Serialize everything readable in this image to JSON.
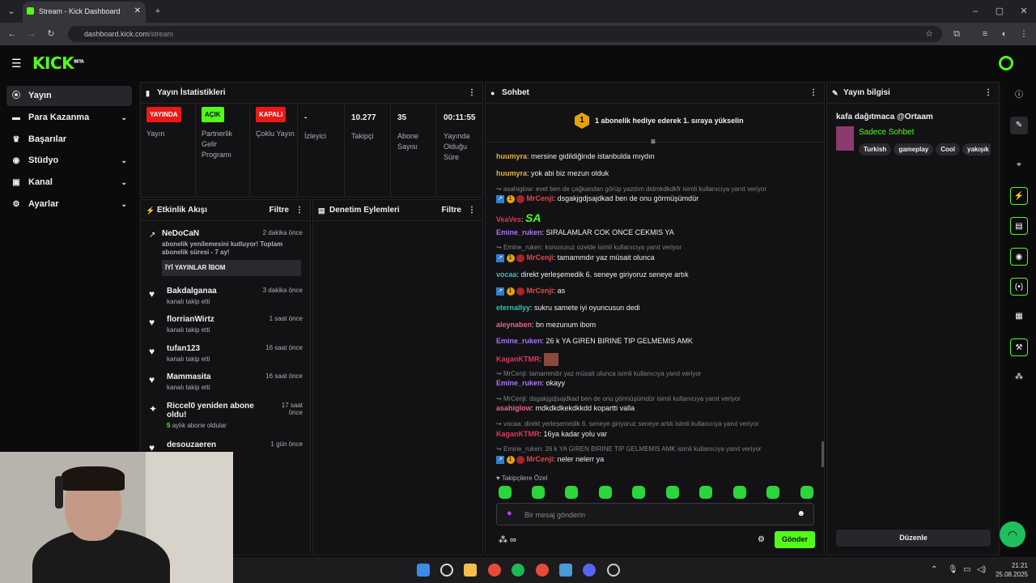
{
  "browser": {
    "tab_title": "Stream - Kick Dashboard",
    "url_domain": "dashboard.kick.com",
    "url_path": "/stream"
  },
  "logo": {
    "text": "KICK",
    "beta": "BETA"
  },
  "sidebar": {
    "items": [
      {
        "label": "Yayın",
        "icon": "stream-icon"
      },
      {
        "label": "Para Kazanma",
        "icon": "money-icon"
      },
      {
        "label": "Başarılar",
        "icon": "trophy-icon"
      },
      {
        "label": "Stüdyo",
        "icon": "studio-icon"
      },
      {
        "label": "Kanal",
        "icon": "channel-icon"
      },
      {
        "label": "Ayarlar",
        "icon": "gear-icon"
      }
    ]
  },
  "stats": {
    "title": "Yayın İstatistikleri",
    "items": [
      {
        "badge": "YAYINDA",
        "label": "Yayın"
      },
      {
        "badge": "AÇIK",
        "label": "Partnerlik Gelir Programı"
      },
      {
        "badge": "KAPALI",
        "label": "Çoklu Yayın"
      },
      {
        "value": "-",
        "label": "İzleyici"
      },
      {
        "value": "10.277",
        "label": "Takipçi"
      },
      {
        "value": "35",
        "label": "Abone Sayısı"
      },
      {
        "value": "00:11:55",
        "label": "Yayında Olduğu Süre"
      }
    ],
    "colors": {
      "live": "#e91916",
      "on": "#53fc18",
      "off": "#e91916"
    }
  },
  "activity": {
    "title": "Etkinlik Akışı",
    "filter": "Filtre",
    "events": [
      {
        "name": "NeDoCaN",
        "time": "2 dakika önce",
        "sub": "abonelik yenilemesini kutluyor! Toplam abonelik süresi - 7 ay!",
        "message": "İYİ YAYINLAR İBOM"
      },
      {
        "name": "Bakdalganaa",
        "time": "3 dakika önce",
        "sub": "kanalı takip etti"
      },
      {
        "name": "florrianWirtz",
        "time": "1 saat önce",
        "sub": "kanalı takip etti"
      },
      {
        "name": "tufan123",
        "time": "16 saat önce",
        "sub": "kanalı takip etti"
      },
      {
        "name": "Mammasita",
        "time": "16 saat önce",
        "sub": "kanalı takip etti"
      },
      {
        "name": "Riccel0 yeniden abone oldu!",
        "time": "17 saat önce",
        "sub_count": "5",
        "sub": "aylık abone oldular"
      },
      {
        "name": "desouzaeren",
        "time": "1 gün önce"
      }
    ]
  },
  "moderation": {
    "title": "Denetim Eylemleri",
    "filter": "Filtre"
  },
  "chat": {
    "title": "Sohbet",
    "goal_number": "1",
    "goal_text": "1 abonelik hediye ederek 1. sıraya yükselin",
    "messages": [
      {
        "user": "huumyra",
        "color": "#e0b341",
        "text": "mersine gidildiğinde istanbulda mıydın"
      },
      {
        "user": "huumyra",
        "color": "#e0b341",
        "text": "yok abi biz mezun olduk"
      },
      {
        "reply": "asahiglow: evet ben de çağkandan görüp yazdım didmkdkdkfr isimli kullanıcıya yanıt veriyor"
      },
      {
        "user": "MrCenji",
        "color": "#e0474c",
        "badges": true,
        "text": "dsgakjgdjsajdkad ben de onu görmüşümdür"
      },
      {
        "user": "VeaVes",
        "color": "#e0365a",
        "emote": "SA"
      },
      {
        "user": "Emine_ruken",
        "color": "#a973f5",
        "text": "SIRALAMLAR COK ONCE CEKMIS YA"
      },
      {
        "reply": "Emine_ruken: konusuruz ozelde isimli kullanıcıya yanıt veriyor"
      },
      {
        "user": "MrCenji",
        "color": "#e0474c",
        "badges": true,
        "text": "tamammdır yaz müsait olunca"
      },
      {
        "user": "vocaa",
        "color": "#2ec4b6",
        "text": "direkt yerleşemedik 6. seneye giriyoruz seneye artık"
      },
      {
        "user": "MrCenji",
        "color": "#e0474c",
        "badges": true,
        "text": "as"
      },
      {
        "user": "eternallyy",
        "color": "#2ec4b6",
        "text": "sukru samete iyi oyuncusun dedi"
      },
      {
        "user": "aleynaben",
        "color": "#e8628e",
        "text": "bn mezunum ibom"
      },
      {
        "user": "Emine_ruken",
        "color": "#a973f5",
        "text": "26 k YA GIREN BIRINE TIP GELMEMIS AMK"
      },
      {
        "user": "KaganKTMR",
        "color": "#e0365a",
        "image": true
      },
      {
        "reply": "MrCenji: tamammdır yaz müsait olunca isimli kullanıcıya yanıt veriyor"
      },
      {
        "user": "Emine_ruken",
        "color": "#a973f5",
        "text": "okayy"
      },
      {
        "reply": "MrCenji: dsgakjgdjsajdkad ben de onu görmüşümdür isimli kullanıcıya yanıt veriyor"
      },
      {
        "user": "asahiglow",
        "color": "#e8628e",
        "text": "mdkdkdkekdkkdd kopartti valla"
      },
      {
        "reply": "vocaa: direkt yerleşemedik 6. seneye giriyoruz seneye artık isimli kullanıcıya yanıt veriyor"
      },
      {
        "user": "KaganKTMR",
        "color": "#e0365a",
        "text": "16ya kadar yolu var"
      },
      {
        "reply": "Emine_ruken: 26 k YA GIREN BIRINE TIP GELMEMIS AMK isimli kullanıcıya yanıt veriyor"
      },
      {
        "user": "MrCenji",
        "color": "#e0474c",
        "badges": true,
        "text": "neler nelerr ya"
      }
    ],
    "followers_only": "Takipçilere Özel",
    "input_placeholder": "Bir mesaj gönderin",
    "send": "Gönder"
  },
  "info": {
    "title": "Yayın bilgisi",
    "stream_title": "kafa dağıtmaca @Ortaam",
    "category": "Sadece Sohbet",
    "tags": [
      "Turkish",
      "gameplay",
      "Cool",
      "yakışık"
    ],
    "edit": "Düzenle"
  },
  "taskbar": {
    "time": "21:21",
    "date": "25.08.2025"
  }
}
